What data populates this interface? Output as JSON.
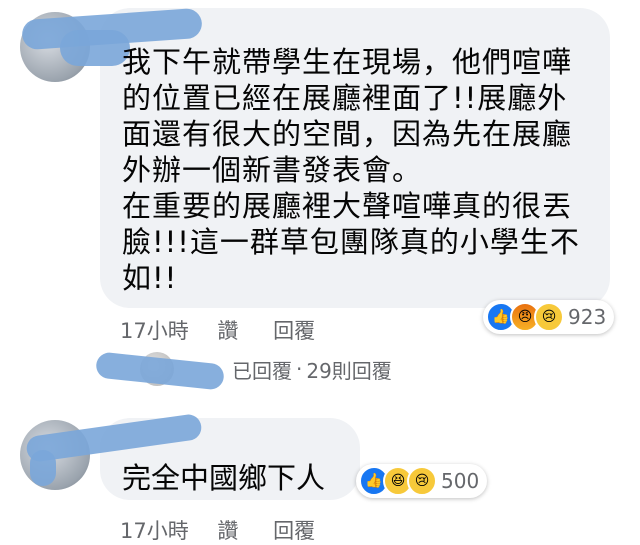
{
  "comment1": {
    "author": "",
    "text": "我下午就帶學生在現場，他們喧嘩的位置已經在展廳裡面了!!展廳外面還有很大的空間，因為先在展廳外辦一個新書發表會。\n在重要的展廳裡大聲喧嘩真的很丟臉!!!這一群草包團隊真的小學生不如!!",
    "time": "17小時",
    "like_label": "讚",
    "reply_label": "回覆",
    "reaction_count": "923",
    "reactions": [
      "like",
      "angry",
      "sad"
    ]
  },
  "replies": {
    "author_suffix": "已回覆",
    "separator": "·",
    "count_label": "29則回覆"
  },
  "comment2": {
    "author": "",
    "text": "完全中國鄉下人",
    "time": "17小時",
    "like_label": "讚",
    "reply_label": "回覆",
    "reaction_count": "500",
    "reactions": [
      "like",
      "haha",
      "sad"
    ]
  },
  "colors": {
    "bubble": "#f0f2f5",
    "meta": "#65676b",
    "like": "#1877f2",
    "redaction": "#7aa6d9"
  }
}
